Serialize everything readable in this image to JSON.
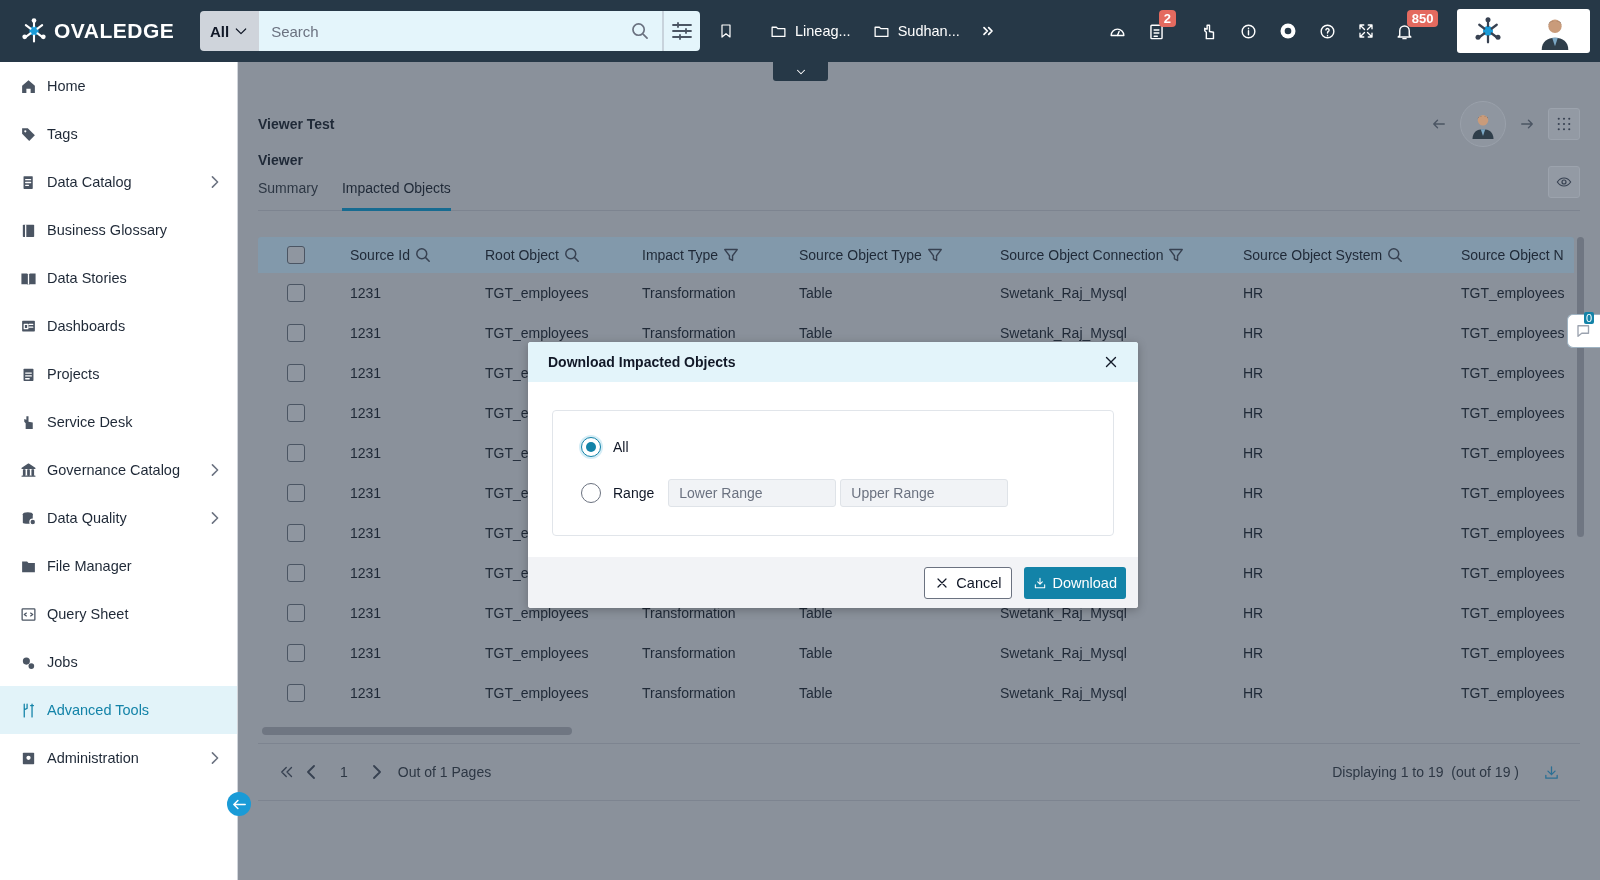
{
  "topbar": {
    "logo": "OVALEDGE",
    "search": {
      "scope": "All",
      "placeholder": "Search"
    },
    "folders": [
      {
        "label": "Lineag..."
      },
      {
        "label": "Sudhan..."
      }
    ],
    "tasks_badge": "2",
    "notifications_badge": "850"
  },
  "sidebar": {
    "items": [
      {
        "label": "Home",
        "expandable": false,
        "selected": false
      },
      {
        "label": "Tags",
        "expandable": false,
        "selected": false
      },
      {
        "label": "Data Catalog",
        "expandable": true,
        "selected": false
      },
      {
        "label": "Business Glossary",
        "expandable": false,
        "selected": false
      },
      {
        "label": "Data Stories",
        "expandable": false,
        "selected": false
      },
      {
        "label": "Dashboards",
        "expandable": false,
        "selected": false
      },
      {
        "label": "Projects",
        "expandable": false,
        "selected": false
      },
      {
        "label": "Service Desk",
        "expandable": false,
        "selected": false
      },
      {
        "label": "Governance Catalog",
        "expandable": true,
        "selected": false
      },
      {
        "label": "Data Quality",
        "expandable": true,
        "selected": false
      },
      {
        "label": "File Manager",
        "expandable": false,
        "selected": false
      },
      {
        "label": "Query Sheet",
        "expandable": false,
        "selected": false
      },
      {
        "label": "Jobs",
        "expandable": false,
        "selected": false
      },
      {
        "label": "Advanced Tools",
        "expandable": false,
        "selected": true
      },
      {
        "label": "Administration",
        "expandable": true,
        "selected": false
      }
    ]
  },
  "page": {
    "title": "Viewer Test",
    "section": "Viewer",
    "tabs": [
      {
        "label": "Summary",
        "selected": false
      },
      {
        "label": "Impacted Objects",
        "selected": true
      }
    ]
  },
  "table": {
    "all_checked": false,
    "columns": [
      {
        "label": "Source Id",
        "kind": "search"
      },
      {
        "label": "Root Object",
        "kind": "search"
      },
      {
        "label": "Impact Type",
        "kind": "filter"
      },
      {
        "label": "Source Object Type",
        "kind": "filter"
      },
      {
        "label": "Source Object Connection",
        "kind": "filter"
      },
      {
        "label": "Source Object System",
        "kind": "search"
      },
      {
        "label": "Source Object N",
        "kind": "plain"
      }
    ],
    "rows": [
      {
        "checked": false,
        "cells": [
          "1231",
          "TGT_employees",
          "Transformation",
          "Table",
          "Swetank_Raj_Mysql",
          "HR",
          "TGT_employees"
        ]
      },
      {
        "checked": false,
        "cells": [
          "1231",
          "TGT_employees",
          "Transformation",
          "Table",
          "Swetank_Raj_Mysql",
          "HR",
          "TGT_employees"
        ]
      },
      {
        "checked": false,
        "cells": [
          "1231",
          "TGT_e",
          null,
          null,
          null,
          "HR",
          "TGT_employees"
        ]
      },
      {
        "checked": false,
        "cells": [
          "1231",
          "TGT_e",
          null,
          null,
          null,
          "HR",
          "TGT_employees"
        ]
      },
      {
        "checked": false,
        "cells": [
          "1231",
          "TGT_e",
          null,
          null,
          null,
          "HR",
          "TGT_employees"
        ]
      },
      {
        "checked": false,
        "cells": [
          "1231",
          "TGT_e",
          null,
          null,
          null,
          "HR",
          "TGT_employees"
        ]
      },
      {
        "checked": false,
        "cells": [
          "1231",
          "TGT_e",
          null,
          null,
          null,
          "HR",
          "TGT_employees"
        ]
      },
      {
        "checked": false,
        "cells": [
          "1231",
          "TGT_e",
          null,
          null,
          null,
          "HR",
          "TGT_employees"
        ]
      },
      {
        "checked": false,
        "cells": [
          "1231",
          "TGT_employees",
          "Transformation",
          "Table",
          "Swetank_Raj_Mysql",
          "HR",
          "TGT_employees"
        ]
      },
      {
        "checked": false,
        "cells": [
          "1231",
          "TGT_employees",
          "Transformation",
          "Table",
          "Swetank_Raj_Mysql",
          "HR",
          "TGT_employees"
        ]
      },
      {
        "checked": false,
        "cells": [
          "1231",
          "TGT_employees",
          "Transformation",
          "Table",
          "Swetank_Raj_Mysql",
          "HR",
          "TGT_employees"
        ]
      }
    ]
  },
  "pagination": {
    "page": "1",
    "pages": "Out of 1 Pages",
    "summary": "Displaying 1 to 19  (out of 19 )"
  },
  "chat_badge": "0",
  "dialog": {
    "title": "Download Impacted Objects",
    "options": [
      {
        "label": "All",
        "selected": true
      },
      {
        "label": "Range",
        "selected": false
      }
    ],
    "lower_placeholder": "Lower Range",
    "upper_placeholder": "Upper Range",
    "cancel": "Cancel",
    "download": "Download"
  }
}
